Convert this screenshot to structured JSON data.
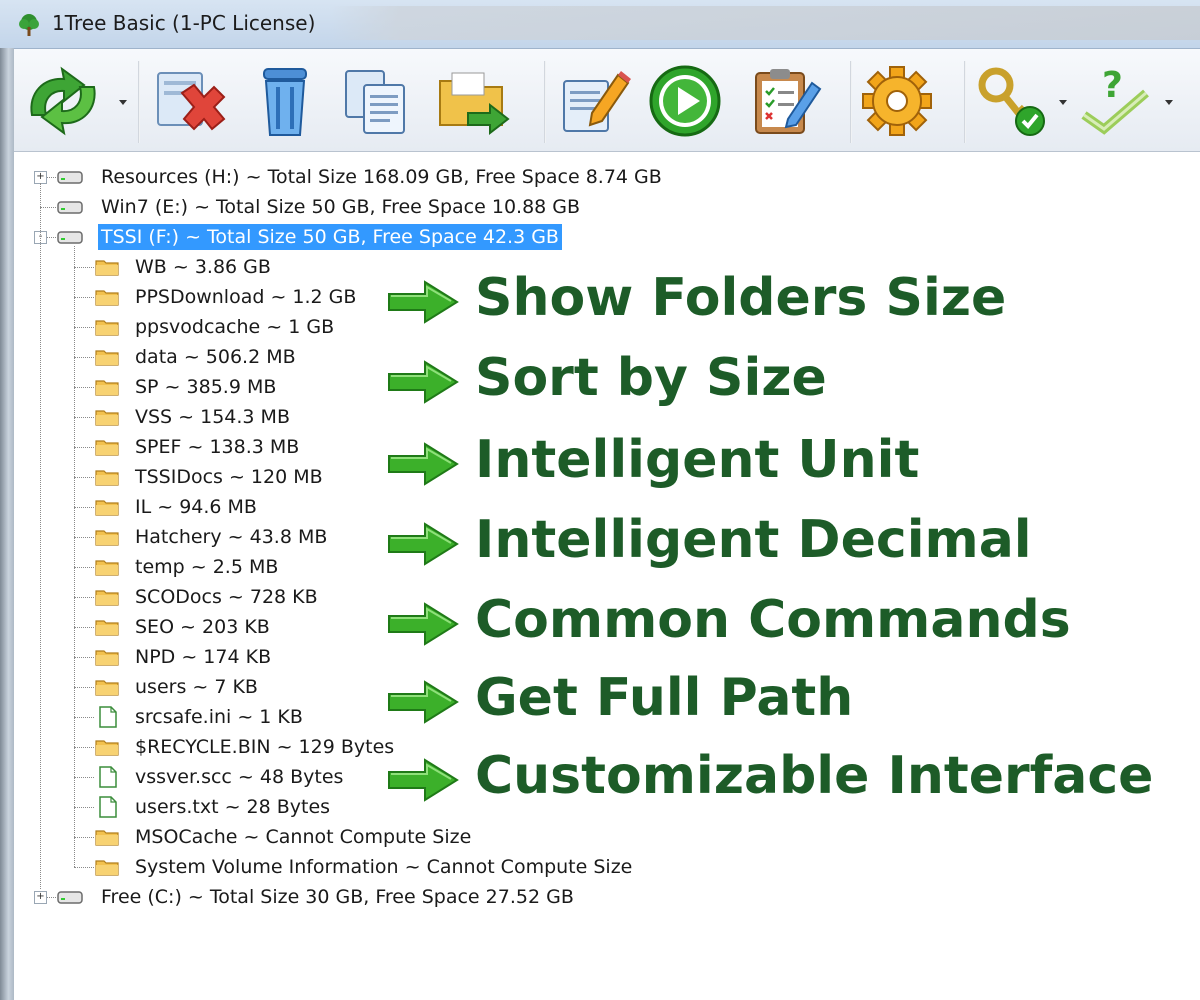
{
  "window": {
    "title": "1Tree Basic (1-PC License)",
    "title_icon": "tree-icon"
  },
  "toolbar": {
    "buttons": [
      {
        "name": "refresh",
        "icon": "refresh-arrows-icon",
        "has_dropdown": true
      },
      {
        "name": "delete",
        "icon": "delete-x-icon",
        "has_dropdown": false
      },
      {
        "name": "recycle-bin",
        "icon": "trash-can-icon",
        "has_dropdown": false
      },
      {
        "name": "copy",
        "icon": "copy-documents-icon",
        "has_dropdown": false
      },
      {
        "name": "move-to-folder",
        "icon": "folder-arrow-icon",
        "has_dropdown": false
      },
      {
        "name": "rename",
        "icon": "edit-pencil-icon",
        "has_dropdown": false
      },
      {
        "name": "run",
        "icon": "play-icon",
        "has_dropdown": false
      },
      {
        "name": "properties",
        "icon": "clipboard-checklist-icon",
        "has_dropdown": false
      },
      {
        "name": "settings",
        "icon": "gear-icon",
        "has_dropdown": false
      },
      {
        "name": "license",
        "icon": "key-check-icon",
        "has_dropdown": true
      },
      {
        "name": "help",
        "icon": "question-check-icon",
        "has_dropdown": true
      }
    ]
  },
  "tree": {
    "drives": [
      {
        "label": "Resources (H:) ~ Total Size 168.09 GB, Free Space 8.74 GB",
        "expander": "+"
      },
      {
        "label": "Win7 (E:) ~ Total Size 50 GB, Free Space 10.88 GB",
        "expander": ""
      },
      {
        "label": "TSSI (F:) ~ Total Size 50 GB, Free Space 42.3 GB",
        "expander": "-",
        "selected": true
      },
      {
        "label": "Free (C:) ~ Total Size 30 GB, Free Space 27.52 GB",
        "expander": "+"
      }
    ],
    "children": [
      {
        "label": "WB ~ 3.86 GB",
        "kind": "folder"
      },
      {
        "label": "PPSDownload ~ 1.2 GB",
        "kind": "folder"
      },
      {
        "label": "ppsvodcache ~ 1 GB",
        "kind": "folder"
      },
      {
        "label": "data ~ 506.2 MB",
        "kind": "folder"
      },
      {
        "label": "SP ~ 385.9 MB",
        "kind": "folder"
      },
      {
        "label": "VSS ~ 154.3 MB",
        "kind": "folder"
      },
      {
        "label": "SPEF ~ 138.3 MB",
        "kind": "folder"
      },
      {
        "label": "TSSIDocs ~ 120 MB",
        "kind": "folder"
      },
      {
        "label": "IL ~ 94.6 MB",
        "kind": "folder"
      },
      {
        "label": "Hatchery ~ 43.8 MB",
        "kind": "folder"
      },
      {
        "label": "temp ~ 2.5 MB",
        "kind": "folder"
      },
      {
        "label": "SCODocs ~ 728 KB",
        "kind": "folder"
      },
      {
        "label": "SEO ~ 203 KB",
        "kind": "folder"
      },
      {
        "label": "NPD ~ 174 KB",
        "kind": "folder"
      },
      {
        "label": "users ~ 7 KB",
        "kind": "folder"
      },
      {
        "label": "srcsafe.ini ~ 1 KB",
        "kind": "file"
      },
      {
        "label": "$RECYCLE.BIN ~ 129 Bytes",
        "kind": "folder"
      },
      {
        "label": "vssver.scc ~ 48 Bytes",
        "kind": "file"
      },
      {
        "label": "users.txt ~ 28 Bytes",
        "kind": "file"
      },
      {
        "label": "MSOCache ~ Cannot Compute Size",
        "kind": "folder"
      },
      {
        "label": "System Volume Information ~ Cannot Compute Size",
        "kind": "folder"
      }
    ]
  },
  "features": [
    "Show Folders Size",
    "Sort by Size",
    "Intelligent Unit",
    "Intelligent Decimal",
    "Common Commands",
    "Get Full Path",
    "Customizable Interface"
  ],
  "colors": {
    "feature_text": "#1d5c28",
    "arrow": "#3cb02a",
    "selection": "#3399ff",
    "folder": "#f2c14e"
  }
}
